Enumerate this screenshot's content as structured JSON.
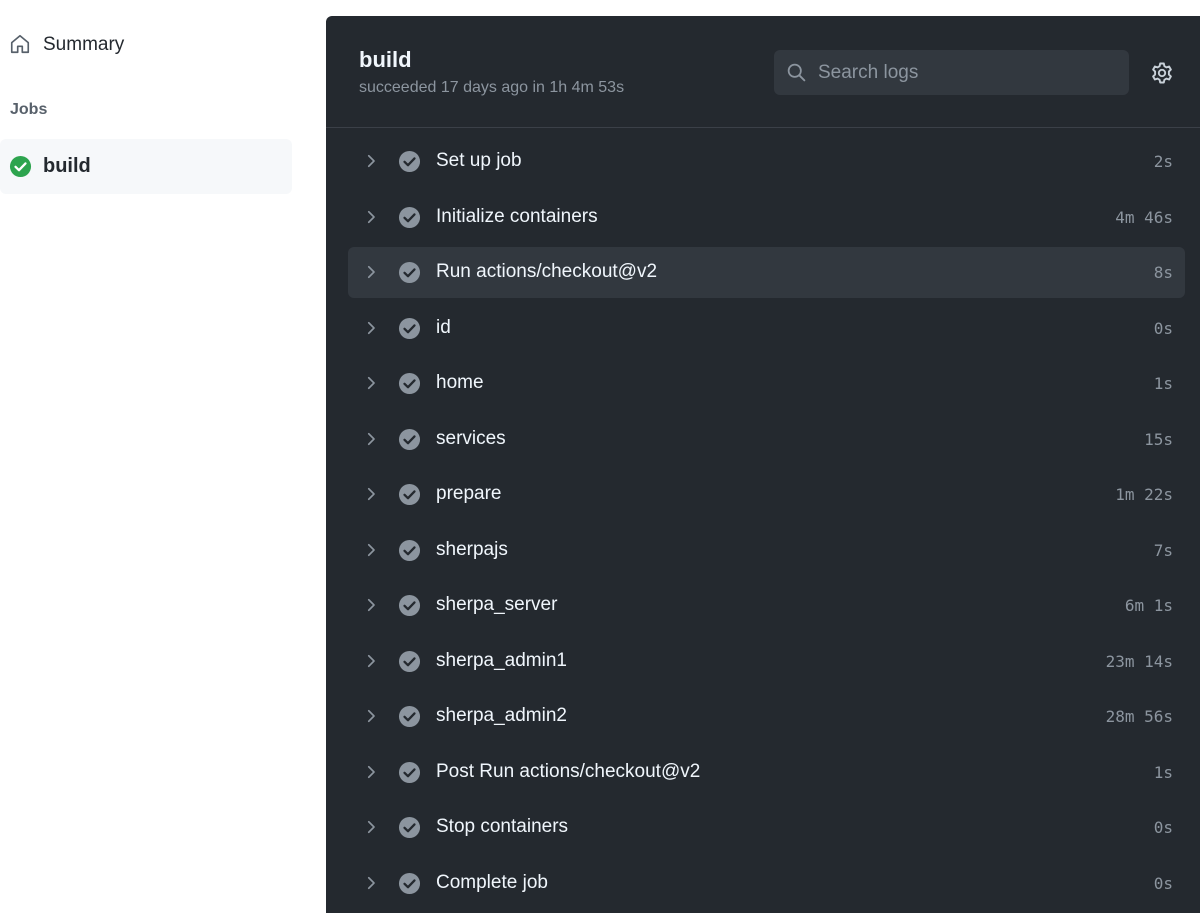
{
  "sidebar": {
    "summary_label": "Summary",
    "jobs_heading": "Jobs",
    "job": {
      "label": "build",
      "status_color": "#2da44e"
    }
  },
  "panel": {
    "title": "build",
    "subtitle": "succeeded 17 days ago in 1h 4m 53s",
    "search": {
      "placeholder": "Search logs",
      "value": ""
    }
  },
  "steps": [
    {
      "name": "Set up job",
      "duration": "2s"
    },
    {
      "name": "Initialize containers",
      "duration": "4m 46s"
    },
    {
      "name": "Run actions/checkout@v2",
      "duration": "8s"
    },
    {
      "name": "id",
      "duration": "0s"
    },
    {
      "name": "home",
      "duration": "1s"
    },
    {
      "name": "services",
      "duration": "15s"
    },
    {
      "name": "prepare",
      "duration": "1m 22s"
    },
    {
      "name": "sherpajs",
      "duration": "7s"
    },
    {
      "name": "sherpa_server",
      "duration": "6m 1s"
    },
    {
      "name": "sherpa_admin1",
      "duration": "23m 14s"
    },
    {
      "name": "sherpa_admin2",
      "duration": "28m 56s"
    },
    {
      "name": "Post Run actions/checkout@v2",
      "duration": "1s"
    },
    {
      "name": "Stop containers",
      "duration": "0s"
    },
    {
      "name": "Complete job",
      "duration": "0s"
    }
  ],
  "icons": {
    "summary": "home-icon",
    "job_status": "check-circle-fill-icon",
    "search": "search-icon",
    "settings": "gear-icon",
    "step_expand": "chevron-right-icon",
    "step_status": "check-circle-icon"
  }
}
